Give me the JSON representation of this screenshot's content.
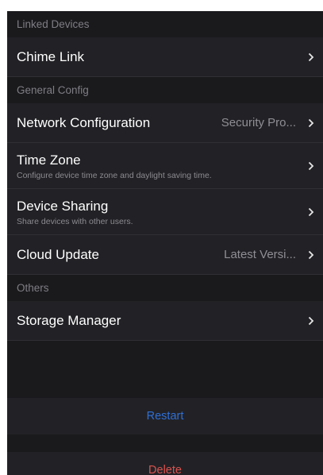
{
  "sections": {
    "linked_devices": {
      "header": "Linked Devices",
      "chime_link": {
        "title": "Chime Link"
      }
    },
    "general_config": {
      "header": "General Config",
      "network_configuration": {
        "title": "Network Configuration",
        "value": "Security Pro..."
      },
      "time_zone": {
        "title": "Time Zone",
        "subtitle": "Configure device time zone and daylight saving time."
      },
      "device_sharing": {
        "title": "Device Sharing",
        "subtitle": "Share devices with other users."
      },
      "cloud_update": {
        "title": "Cloud Update",
        "value": "Latest Versi..."
      }
    },
    "others": {
      "header": "Others",
      "storage_manager": {
        "title": "Storage Manager"
      }
    }
  },
  "actions": {
    "restart_label": "Restart",
    "delete_label": "Delete"
  },
  "colors": {
    "restart": "#2f6fd6",
    "delete": "#d9534f",
    "background": "#1a1a1d",
    "row_background": "#222226"
  },
  "icons": {
    "row_chevron": "chevron-right-icon"
  }
}
